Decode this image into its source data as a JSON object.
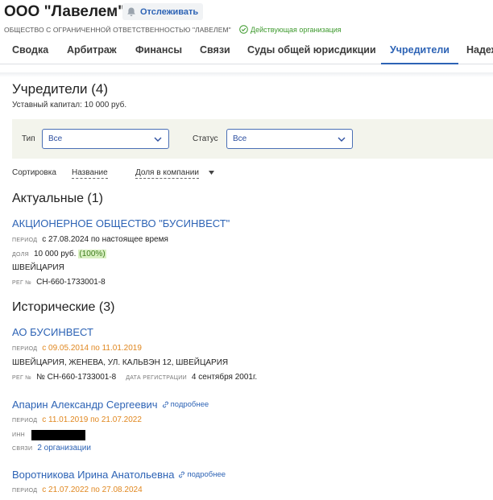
{
  "header": {
    "company_title": "ООО \"Лавелем\"",
    "follow_label": "Отслеживать",
    "company_full_name": "ОБЩЕСТВО С ОГРАНИЧЕННОЙ ОТВЕТСТВЕННОСТЬЮ \"ЛАВЕЛЕМ\"",
    "status_text": "Действующая организация",
    "status_color": "#3f9a2f"
  },
  "tabs": [
    {
      "label": "Сводка"
    },
    {
      "label": "Арбитраж"
    },
    {
      "label": "Финансы"
    },
    {
      "label": "Связи"
    },
    {
      "label": "Суды общей юрисдикции"
    },
    {
      "label": "Учредители"
    },
    {
      "label": "Надеж"
    }
  ],
  "active_tab": "Учредители",
  "accent_color": "#2d63b5",
  "main": {
    "title": "Учредители (4)",
    "capital": "Уставный капитал: 10 000 руб."
  },
  "filters": {
    "type_label": "Тип",
    "type_value": "Все",
    "status_label": "Статус",
    "status_value": "Все"
  },
  "sorting": {
    "label": "Сортировка",
    "option_name": "Название",
    "option_share": "Доля в компании"
  },
  "current": {
    "heading": "Актуальные (1)",
    "items": [
      {
        "name": "АКЦИОНЕРНОЕ ОБЩЕСТВО \"БУСИНВЕСТ\"",
        "period_label": "ПЕРИОД",
        "period": "с 27.08.2024 по настоящее время",
        "share_label": "ДОЛЯ",
        "share_amount": "10 000 руб.",
        "share_percent": "(100%)",
        "country": "ШВЕЙЦАРИЯ",
        "reg_label": "РЕГ №",
        "reg_number": "CH-660-1733001-8"
      }
    ]
  },
  "historical": {
    "heading": "Исторические (3)",
    "org": {
      "name": "АО БУСИНВЕСТ",
      "period_label": "ПЕРИОД",
      "period": "с 09.05.2014 по 11.01.2019",
      "address": "ШВЕЙЦАРИЯ, ЖЕНЕВА, УЛ. КАЛЬВЭН 12, ШВЕЙЦАРИЯ",
      "reg_label": "РЕГ №",
      "reg_number": "№ CH-660-1733001-8",
      "reg_date_label": "ДАТА РЕГИСТРАЦИИ",
      "reg_date": "4 сентября 2001г."
    },
    "person1": {
      "name": "Апарин Александр Сергеевич",
      "more": "подробнее",
      "period_label": "ПЕРИОД",
      "period": "с 11.01.2019 по 21.07.2022",
      "inn_label": "ИНН",
      "links_label": "СВЯЗИ",
      "links_value": "2 организации"
    },
    "person2": {
      "name": "Воротникова Ирина Анатольевна",
      "more": "подробнее",
      "period_label": "ПЕРИОД",
      "period": "с 21.07.2022 по 27.08.2024"
    }
  }
}
